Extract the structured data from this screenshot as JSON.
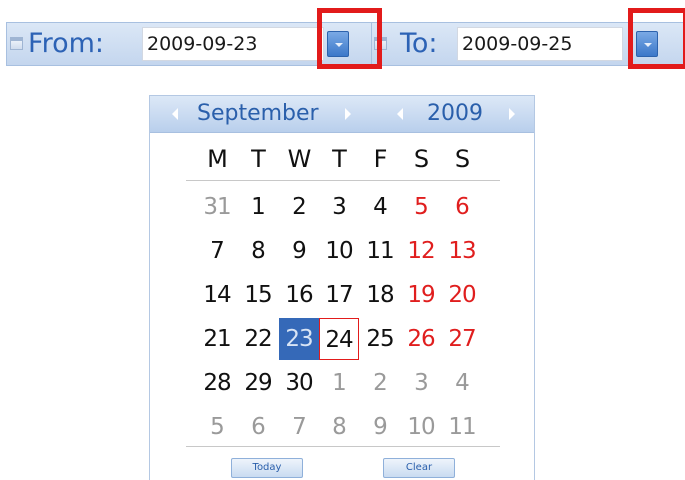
{
  "from_field": {
    "label": "From:",
    "value": "2009-09-23"
  },
  "to_field": {
    "label": "To:",
    "value": "2009-09-25"
  },
  "calendar": {
    "month": "September",
    "year": "2009",
    "weekdays": [
      "M",
      "T",
      "W",
      "T",
      "F",
      "S",
      "S"
    ],
    "weeks": [
      [
        "31",
        "1",
        "2",
        "3",
        "4",
        "5",
        "6"
      ],
      [
        "7",
        "8",
        "9",
        "10",
        "11",
        "12",
        "13"
      ],
      [
        "14",
        "15",
        "16",
        "17",
        "18",
        "19",
        "20"
      ],
      [
        "21",
        "22",
        "23",
        "24",
        "25",
        "26",
        "27"
      ],
      [
        "28",
        "29",
        "30",
        "1",
        "2",
        "3",
        "4"
      ],
      [
        "5",
        "6",
        "7",
        "8",
        "9",
        "10",
        "11"
      ]
    ],
    "selected_day": "23",
    "today_day": "24",
    "today_button": "Today",
    "clear_button": "Clear"
  },
  "colors": {
    "label_blue": "#2c62b5",
    "selected_bg": "#3569b8",
    "weekend_red": "#e01e1e",
    "highlight_red": "#e21b1b",
    "other_month_gray": "#9a9a9a"
  },
  "icons": {
    "field_icon": "calendar-icon",
    "dropdown": "chevron-down-icon",
    "prev": "chevron-left-icon",
    "next": "chevron-right-icon"
  }
}
